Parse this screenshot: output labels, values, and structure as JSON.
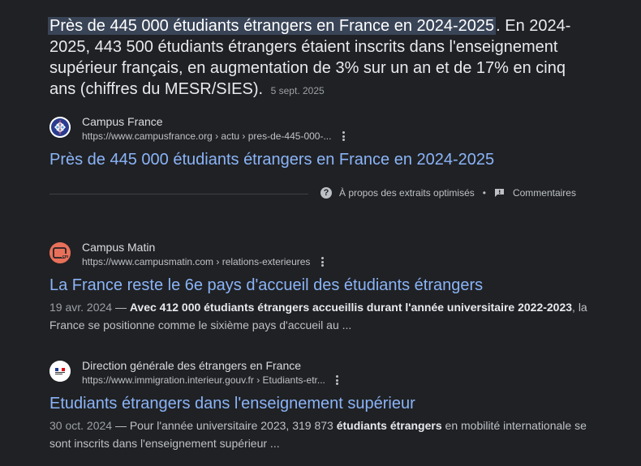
{
  "snippet": {
    "highlight": "Près de 445 000 étudiants étrangers en France en 2024-2025",
    "body": ". En 2024-2025, 443 500 étudiants étrangers étaient inscrits dans l'enseignement supérieur français, en augmentation de 3% sur un an et de 17% en cinq ans (chiffres du MESR/SIES).",
    "date": "5 sept. 2025"
  },
  "featured_source": {
    "site_name": "Campus France",
    "url": "https://www.campusfrance.org › actu › pres-de-445-000-...",
    "title": "Près de 445 000 étudiants étrangers en France en 2024-2025",
    "icon": "campus-france-logo"
  },
  "snippet_footer": {
    "about_label": "À propos des extraits optimisés",
    "separator": "•",
    "feedback_label": "Commentaires"
  },
  "results": [
    {
      "site_name": "Campus Matin",
      "url": "https://www.campusmatin.com › relations-exterieures",
      "title": "La France reste le 6e pays d'accueil des étudiants étrangers",
      "date": "19 avr. 2024",
      "dash": " — ",
      "desc_bold": "Avec 412 000 étudiants étrangers accueillis durant l'année universitaire 2022-2023",
      "desc_rest": ", la France se positionne comme le sixième pays d'accueil au ...",
      "icon": "campus-matin-logo",
      "icon_color": "#e8705a"
    },
    {
      "site_name": "Direction générale des étrangers en France",
      "url": "https://www.immigration.interieur.gouv.fr › Etudiants-etr...",
      "title": "Etudiants étrangers dans l'enseignement supérieur",
      "date": "30 oct. 2024",
      "dash": " — ",
      "desc_pre": "Pour l'année universitaire 2023, 319 873 ",
      "desc_bold": "étudiants étrangers",
      "desc_rest": " en mobilité internationale se sont inscrits dans l'enseignement supérieur ...",
      "icon": "marianne-logo"
    }
  ],
  "colors": {
    "background": "#202124",
    "link": "#8ab4f8",
    "highlight": "#394457"
  }
}
